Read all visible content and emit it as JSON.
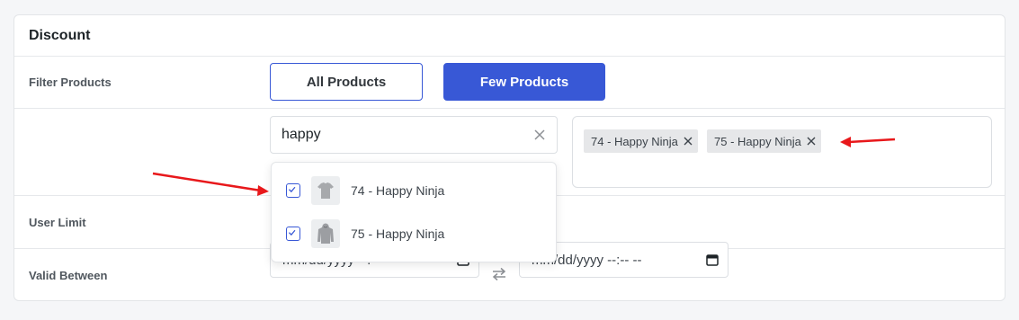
{
  "section": {
    "title": "Discount"
  },
  "rows": {
    "filter_label": "Filter Products",
    "user_limit_label": "User Limit",
    "valid_between_label": "Valid Between"
  },
  "filter_buttons": {
    "all": "All Products",
    "few": "Few Products",
    "active": "few"
  },
  "search": {
    "value": "happy",
    "clear_icon": "close-icon"
  },
  "selected_products": [
    {
      "label": "74 - Happy Ninja"
    },
    {
      "label": "75 - Happy Ninja"
    }
  ],
  "dropdown_options": [
    {
      "label": "74 - Happy Ninja",
      "checked": true,
      "thumb": "tshirt-thumbnail"
    },
    {
      "label": "75 - Happy Ninja",
      "checked": true,
      "thumb": "hoodie-thumbnail"
    }
  ],
  "valid_between": {
    "start_placeholder": "mm/dd/yyyy --:-- --",
    "end_placeholder": "mm/dd/yyyy --:-- --",
    "icons": [
      "calendar-icon",
      "swap-icon"
    ]
  },
  "colors": {
    "accent": "#3858d6",
    "annotation_arrow": "#e8181b",
    "chip_bg": "#e6e7e9"
  }
}
